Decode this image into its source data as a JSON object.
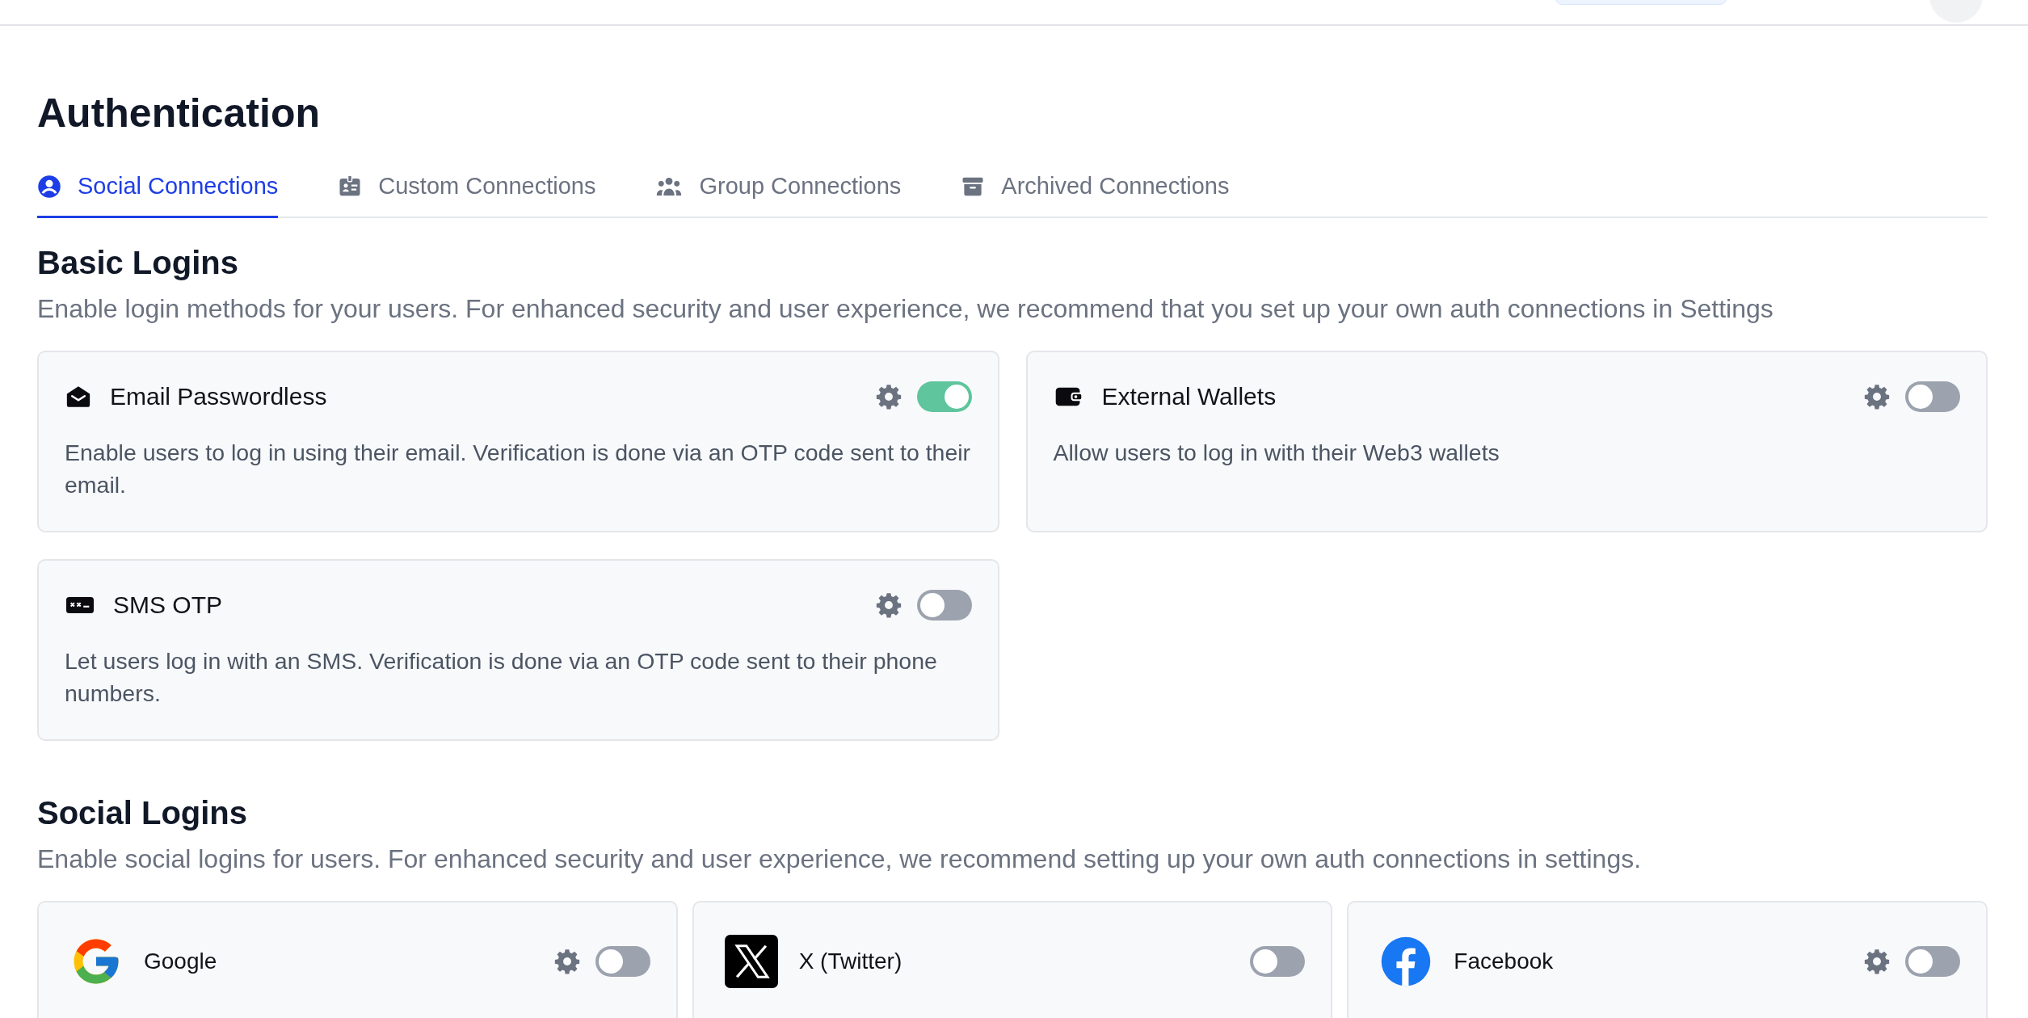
{
  "page": {
    "title": "Authentication"
  },
  "tabs": [
    {
      "label": "Social Connections",
      "kind": "user",
      "selected": true
    },
    {
      "label": "Custom Connections",
      "kind": "badge",
      "selected": false
    },
    {
      "label": "Group Connections",
      "kind": "group",
      "selected": false
    },
    {
      "label": "Archived Connections",
      "kind": "archive",
      "selected": false
    }
  ],
  "sections": [
    {
      "title": "Basic Logins",
      "description": "Enable login methods for your users. For enhanced security and user experience, we recommend that you set up your own auth connections in Settings",
      "cards": [
        {
          "name": "Email Passwordless",
          "kind": "mail",
          "description": "Enable users to log in using their email. Verification is done via an OTP code sent to their email.",
          "settings": true,
          "on": true
        },
        {
          "name": "External Wallets",
          "kind": "wallet",
          "description": "Allow users to log in with their Web3 wallets",
          "settings": true,
          "on": false
        },
        {
          "name": "SMS OTP",
          "kind": "sms",
          "description": "Let users log in with an SMS. Verification is done via an OTP code sent to their phone numbers.",
          "settings": true,
          "on": false
        }
      ]
    },
    {
      "title": "Social Logins",
      "description": "Enable social logins for users. For enhanced security and user experience, we recommend setting up your own auth connections in settings.",
      "cards": [
        {
          "name": "Google",
          "kind": "google",
          "settings": true,
          "on": false
        },
        {
          "name": "X (Twitter)",
          "kind": "x",
          "settings": false,
          "on": false
        },
        {
          "name": "Facebook",
          "kind": "facebook",
          "settings": true,
          "on": false
        }
      ]
    }
  ]
}
